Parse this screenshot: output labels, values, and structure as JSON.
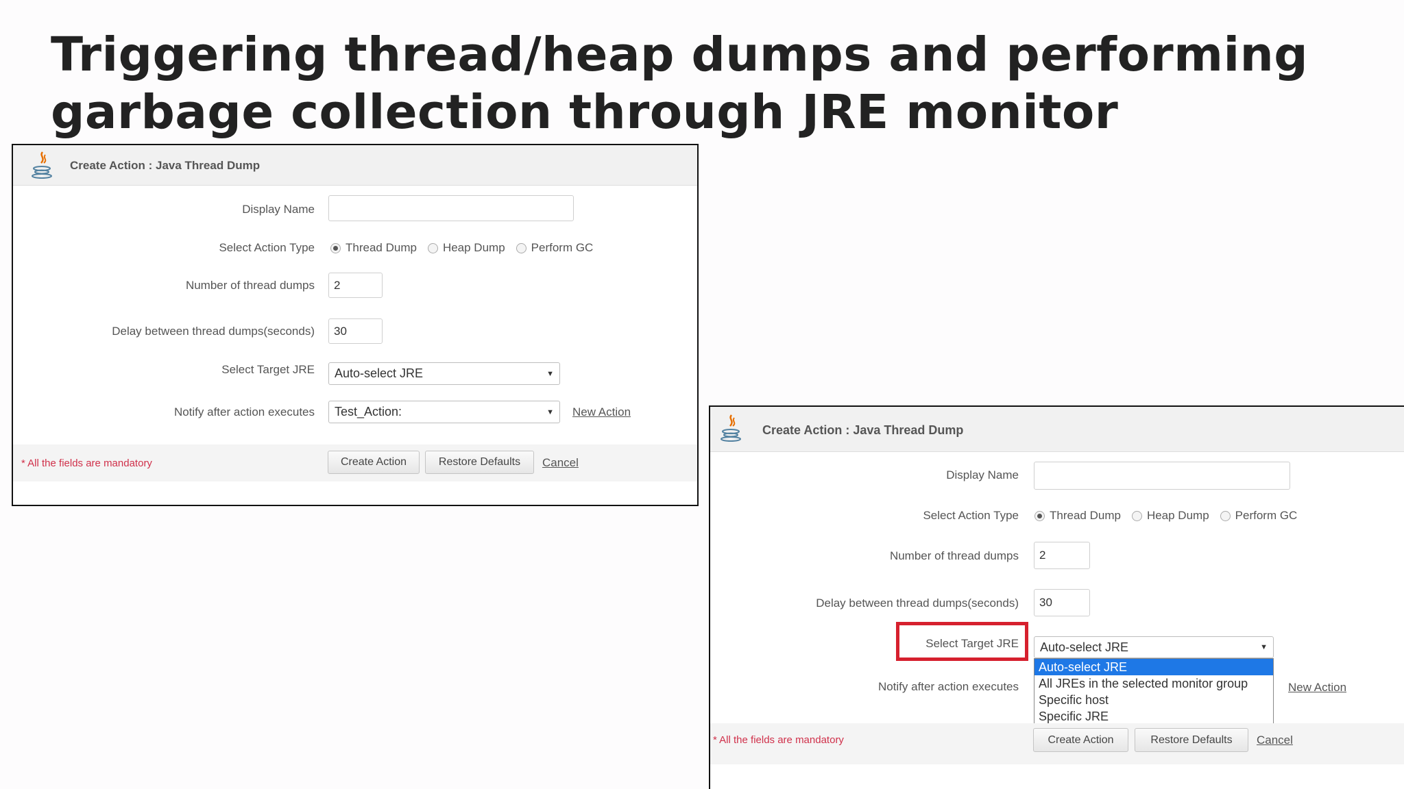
{
  "slide": {
    "title_line1": "Triggering thread/heap dumps and performing",
    "title_line2": "garbage collection through JRE monitor"
  },
  "form": {
    "header_title": "Create Action : Java Thread Dump",
    "labels": {
      "display_name": "Display Name",
      "action_type": "Select Action Type",
      "num_dumps": "Number of thread dumps",
      "delay": "Delay between thread dumps(seconds)",
      "target_jre": "Select Target JRE",
      "notify": "Notify after action executes"
    },
    "display_name_value": "",
    "action_types": [
      "Thread Dump",
      "Heap Dump",
      "Perform GC"
    ],
    "selected_action_type": "Thread Dump",
    "num_dumps_value": "2",
    "delay_value": "30",
    "target_jre_value": "Auto-select JRE",
    "notify_value": "Test_Action:",
    "new_action_link": "New Action",
    "mandatory_note": "* All the fields are mandatory",
    "buttons": {
      "create": "Create Action",
      "restore": "Restore Defaults",
      "cancel": "Cancel"
    },
    "target_jre_options": [
      "Auto-select JRE",
      "All JREs in the selected monitor group",
      "Specific host",
      "Specific JRE"
    ],
    "highlighted_option": "Auto-select JRE"
  },
  "colors": {
    "highlight_border": "#d6202e",
    "selected_option_bg": "#1e78e6",
    "mandatory_text": "#d0304a"
  }
}
